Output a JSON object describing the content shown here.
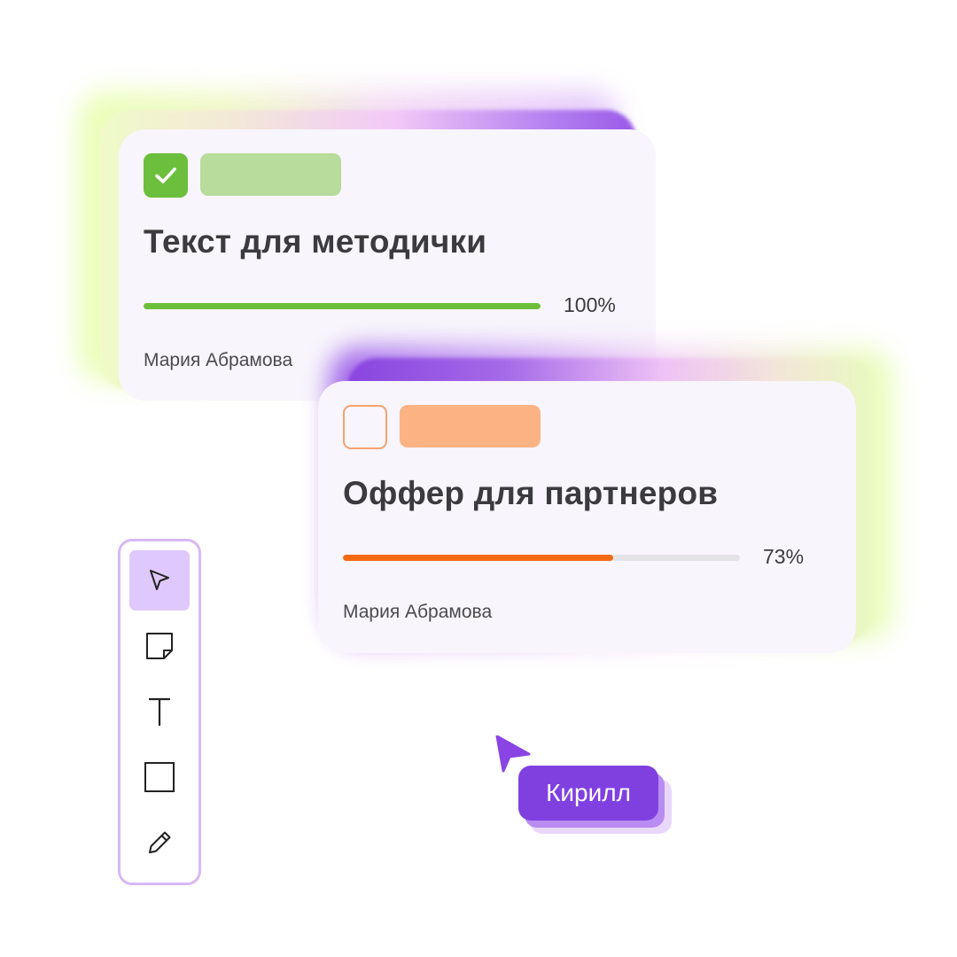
{
  "tasks": [
    {
      "title": "Текст для методички",
      "progress_label": "100%",
      "progress_fraction": 1.0,
      "author": "Мария Абрамова",
      "checked": true,
      "accent_color": "#6cbf3c",
      "tag_color": "#b7dc9c"
    },
    {
      "title": "Оффер для партнеров",
      "progress_label": "73%",
      "progress_fraction": 0.68,
      "author": "Мария Абрамова",
      "checked": false,
      "accent_color": "#f36a12",
      "tag_color": "#fbb383"
    }
  ],
  "toolbar": {
    "tools": [
      {
        "name": "select",
        "icon": "pointer-arrow-icon",
        "active": true
      },
      {
        "name": "sticky-note",
        "icon": "sticky-note-icon",
        "active": false
      },
      {
        "name": "text",
        "icon": "text-icon",
        "active": false
      },
      {
        "name": "rectangle",
        "icon": "square-icon",
        "active": false
      },
      {
        "name": "pen",
        "icon": "pencil-icon",
        "active": false
      }
    ],
    "border_color": "#d8b8f5",
    "active_color": "#dfc8fb"
  },
  "collaborator": {
    "name": "Кирилл",
    "color": "#8040e0"
  }
}
